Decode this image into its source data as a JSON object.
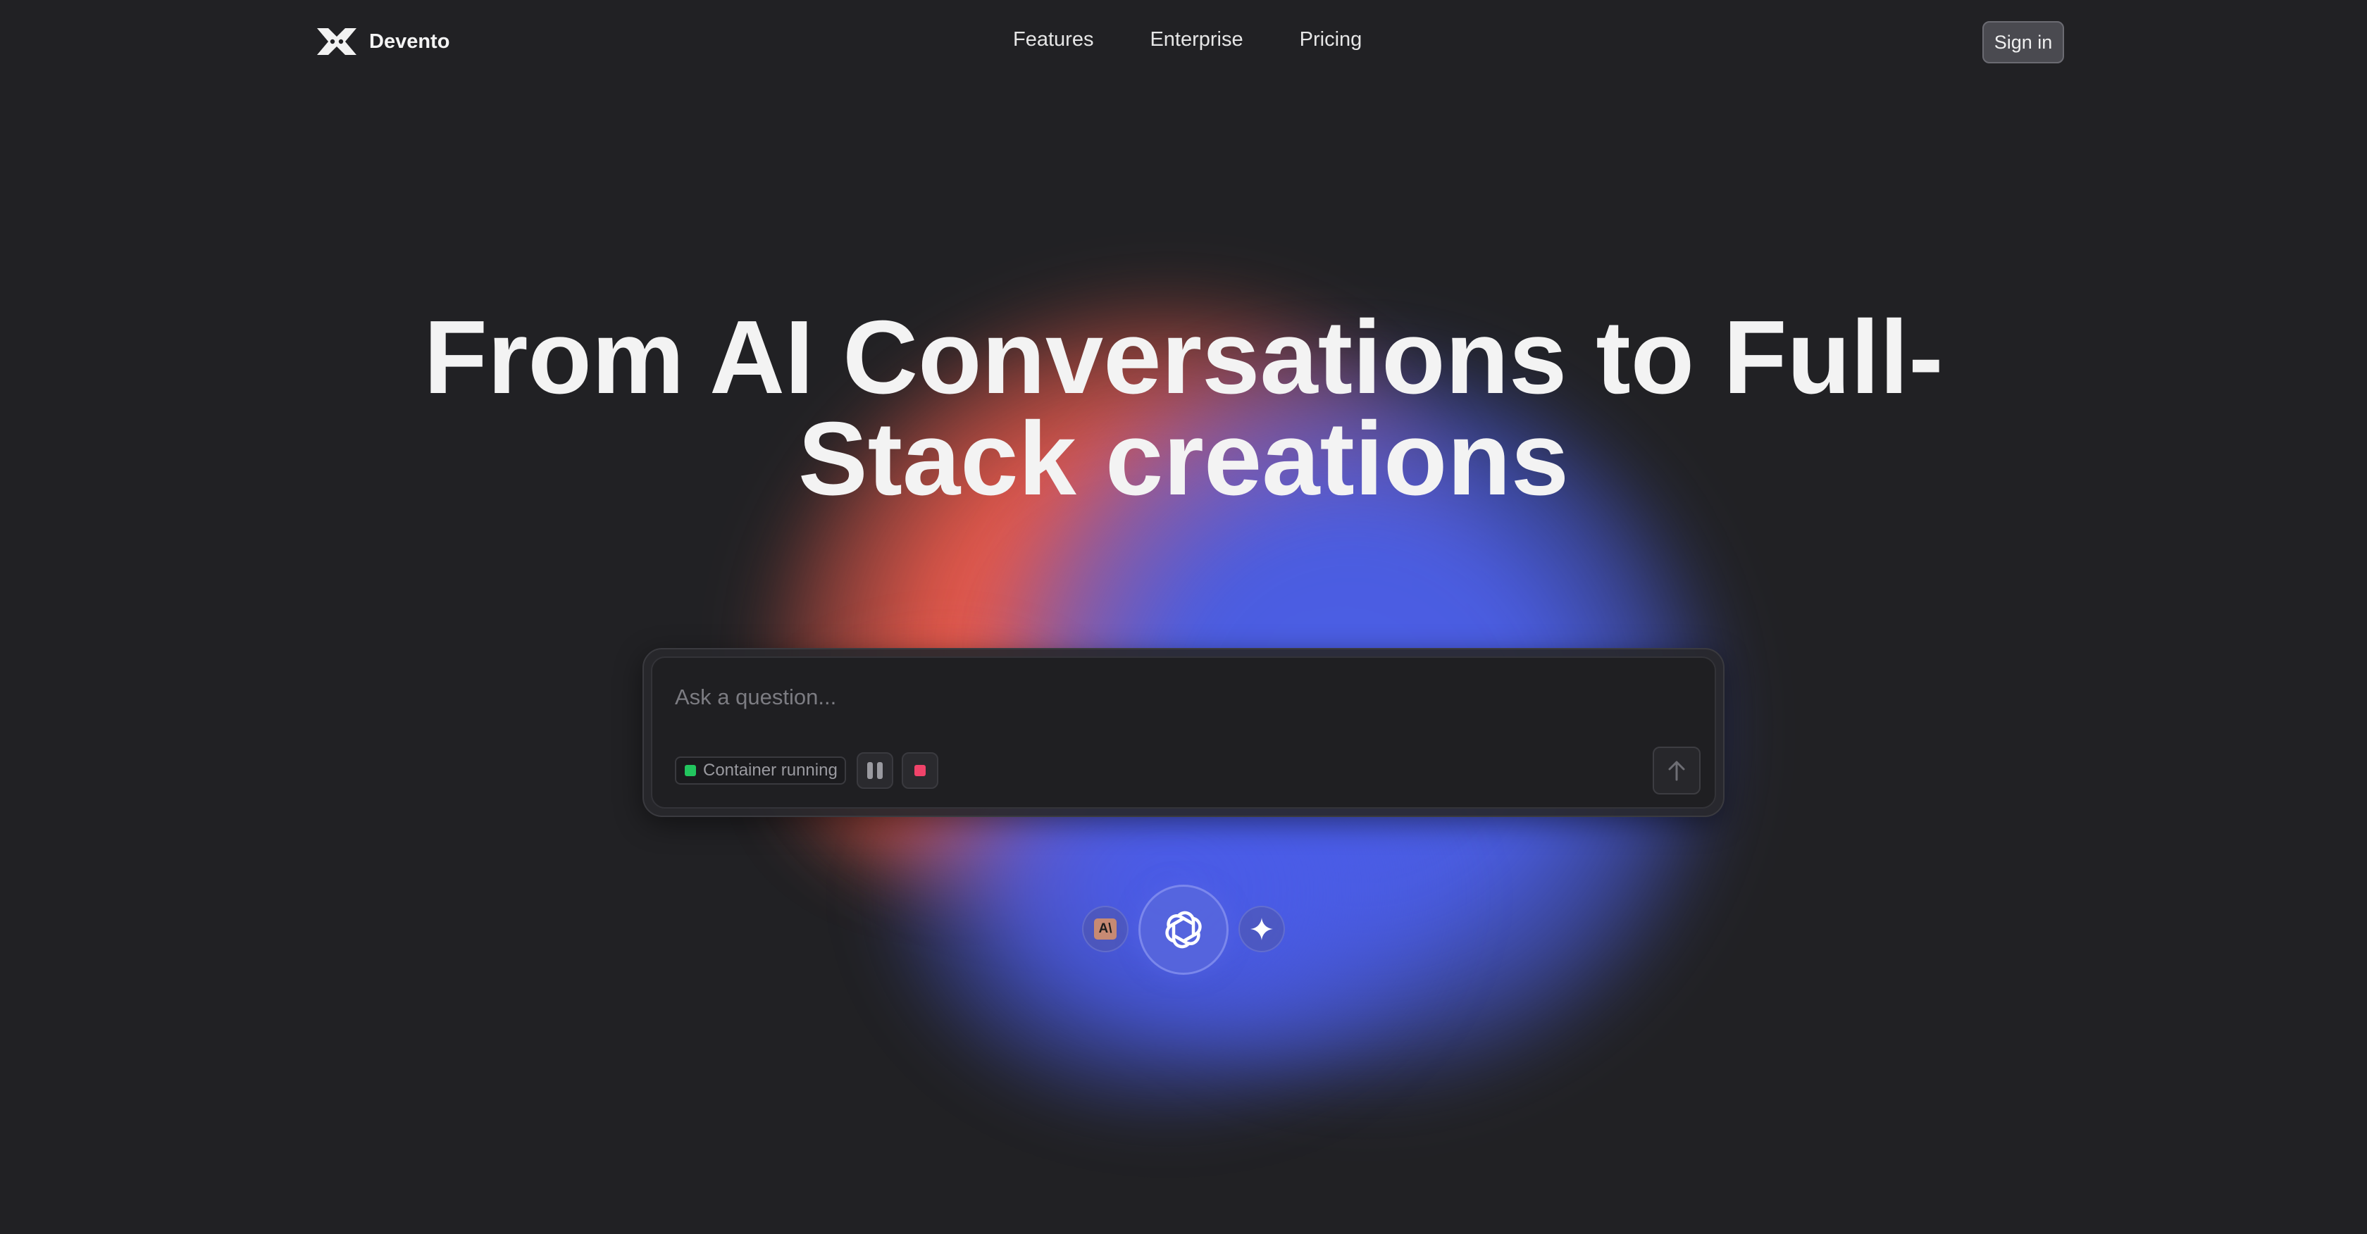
{
  "header": {
    "brand_name": "Devento",
    "nav": [
      {
        "label": "Features"
      },
      {
        "label": "Enterprise"
      },
      {
        "label": "Pricing"
      }
    ],
    "signin_label": "Sign in"
  },
  "hero": {
    "title_line1": "From AI Conversations to Full-",
    "title_line2": "Stack creations"
  },
  "prompt": {
    "placeholder": "Ask a question...",
    "value": "",
    "status_label": "Container running",
    "status_color": "#22c55e",
    "stop_color": "#f0436a"
  },
  "models": {
    "anthropic_badge": "A\\",
    "items": [
      {
        "name": "anthropic-icon"
      },
      {
        "name": "openai-icon"
      },
      {
        "name": "gemini-sparkle-icon"
      }
    ]
  },
  "colors": {
    "background": "#212124",
    "blob_red": "#e85a4a",
    "blob_blue": "#4c5ee6"
  }
}
